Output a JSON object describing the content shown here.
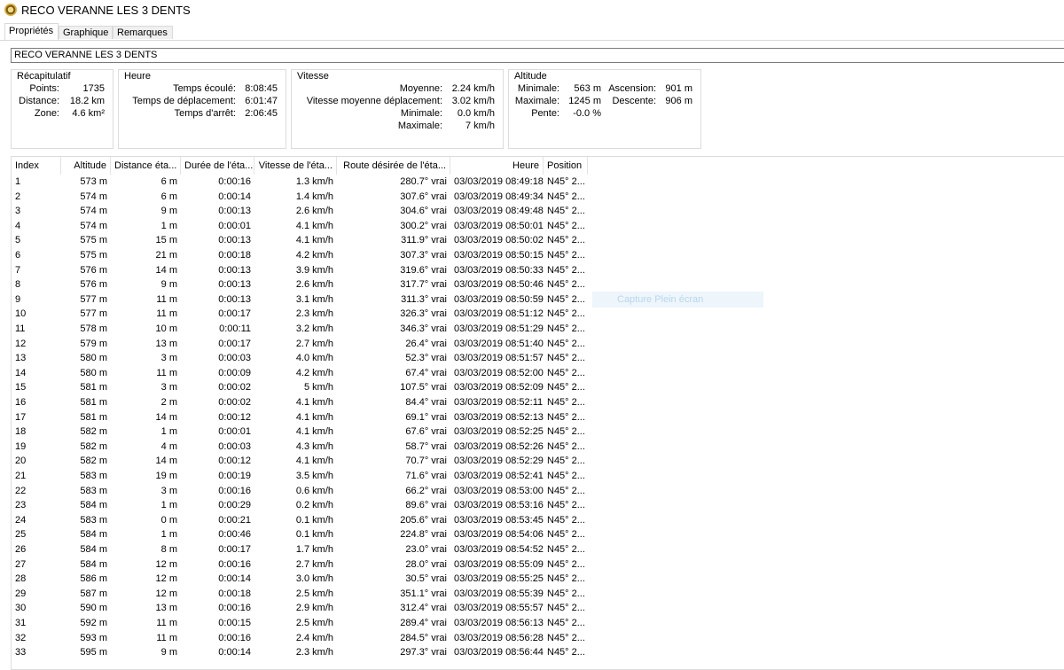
{
  "window": {
    "title": "RECO VERANNE LES 3 DENTS"
  },
  "tabs": [
    "Propriétés",
    "Graphique",
    "Remarques"
  ],
  "name_field": "RECO VERANNE LES 3 DENTS",
  "summary": {
    "title": "Récapitulatif",
    "points_label": "Points:",
    "points": "1735",
    "distance_label": "Distance:",
    "distance": "18.2 km",
    "zone_label": "Zone:",
    "zone": "4.6 km²"
  },
  "heure": {
    "title": "Heure",
    "elapsed_label": "Temps écoulé:",
    "elapsed": "8:08:45",
    "moving_label": "Temps de déplacement:",
    "moving": "6:01:47",
    "stopped_label": "Temps d'arrêt:",
    "stopped": "2:06:45"
  },
  "vitesse": {
    "title": "Vitesse",
    "avg_label": "Moyenne:",
    "avg": "2.24 km/h",
    "avg_moving_label": "Vitesse moyenne déplacement:",
    "avg_moving": "3.02 km/h",
    "min_label": "Minimale:",
    "min": "0.0 km/h",
    "max_label": "Maximale:",
    "max": "7 km/h"
  },
  "altitude": {
    "title": "Altitude",
    "min_label": "Minimale:",
    "min": "563 m",
    "max_label": "Maximale:",
    "max": "1245 m",
    "slope_label": "Pente:",
    "slope": "-0.0 %",
    "ascent_label": "Ascension:",
    "ascent": "901 m",
    "descent_label": "Descente:",
    "descent": "906 m"
  },
  "table": {
    "headers": [
      "Index",
      "Altitude",
      "Distance éta...",
      "Durée de l'éta...",
      "Vitesse de l'éta...",
      "Route désirée de l'éta...",
      "Heure",
      "Position"
    ],
    "rows": [
      [
        "1",
        "573 m",
        "6 m",
        "0:00:16",
        "1.3 km/h",
        "280.7° vrai",
        "03/03/2019 08:49:18",
        "N45° 2..."
      ],
      [
        "2",
        "574 m",
        "6 m",
        "0:00:14",
        "1.4 km/h",
        "307.6° vrai",
        "03/03/2019 08:49:34",
        "N45° 2..."
      ],
      [
        "3",
        "574 m",
        "9 m",
        "0:00:13",
        "2.6 km/h",
        "304.6° vrai",
        "03/03/2019 08:49:48",
        "N45° 2..."
      ],
      [
        "4",
        "574 m",
        "1 m",
        "0:00:01",
        "4.1 km/h",
        "300.2° vrai",
        "03/03/2019 08:50:01",
        "N45° 2..."
      ],
      [
        "5",
        "575 m",
        "15 m",
        "0:00:13",
        "4.1 km/h",
        "311.9° vrai",
        "03/03/2019 08:50:02",
        "N45° 2..."
      ],
      [
        "6",
        "575 m",
        "21 m",
        "0:00:18",
        "4.2 km/h",
        "307.3° vrai",
        "03/03/2019 08:50:15",
        "N45° 2..."
      ],
      [
        "7",
        "576 m",
        "14 m",
        "0:00:13",
        "3.9 km/h",
        "319.6° vrai",
        "03/03/2019 08:50:33",
        "N45° 2..."
      ],
      [
        "8",
        "576 m",
        "9 m",
        "0:00:13",
        "2.6 km/h",
        "317.7° vrai",
        "03/03/2019 08:50:46",
        "N45° 2..."
      ],
      [
        "9",
        "577 m",
        "11 m",
        "0:00:13",
        "3.1 km/h",
        "311.3° vrai",
        "03/03/2019 08:50:59",
        "N45° 2..."
      ],
      [
        "10",
        "577 m",
        "11 m",
        "0:00:17",
        "2.3 km/h",
        "326.3° vrai",
        "03/03/2019 08:51:12",
        "N45° 2..."
      ],
      [
        "11",
        "578 m",
        "10 m",
        "0:00:11",
        "3.2 km/h",
        "346.3° vrai",
        "03/03/2019 08:51:29",
        "N45° 2..."
      ],
      [
        "12",
        "579 m",
        "13 m",
        "0:00:17",
        "2.7 km/h",
        "26.4° vrai",
        "03/03/2019 08:51:40",
        "N45° 2..."
      ],
      [
        "13",
        "580 m",
        "3 m",
        "0:00:03",
        "4.0 km/h",
        "52.3° vrai",
        "03/03/2019 08:51:57",
        "N45° 2..."
      ],
      [
        "14",
        "580 m",
        "11 m",
        "0:00:09",
        "4.2 km/h",
        "67.4° vrai",
        "03/03/2019 08:52:00",
        "N45° 2..."
      ],
      [
        "15",
        "581 m",
        "3 m",
        "0:00:02",
        "5 km/h",
        "107.5° vrai",
        "03/03/2019 08:52:09",
        "N45° 2..."
      ],
      [
        "16",
        "581 m",
        "2 m",
        "0:00:02",
        "4.1 km/h",
        "84.4° vrai",
        "03/03/2019 08:52:11",
        "N45° 2..."
      ],
      [
        "17",
        "581 m",
        "14 m",
        "0:00:12",
        "4.1 km/h",
        "69.1° vrai",
        "03/03/2019 08:52:13",
        "N45° 2..."
      ],
      [
        "18",
        "582 m",
        "1 m",
        "0:00:01",
        "4.1 km/h",
        "67.6° vrai",
        "03/03/2019 08:52:25",
        "N45° 2..."
      ],
      [
        "19",
        "582 m",
        "4 m",
        "0:00:03",
        "4.3 km/h",
        "58.7° vrai",
        "03/03/2019 08:52:26",
        "N45° 2..."
      ],
      [
        "20",
        "582 m",
        "14 m",
        "0:00:12",
        "4.1 km/h",
        "70.7° vrai",
        "03/03/2019 08:52:29",
        "N45° 2..."
      ],
      [
        "21",
        "583 m",
        "19 m",
        "0:00:19",
        "3.5 km/h",
        "71.6° vrai",
        "03/03/2019 08:52:41",
        "N45° 2..."
      ],
      [
        "22",
        "583 m",
        "3 m",
        "0:00:16",
        "0.6 km/h",
        "66.2° vrai",
        "03/03/2019 08:53:00",
        "N45° 2..."
      ],
      [
        "23",
        "584 m",
        "1 m",
        "0:00:29",
        "0.2 km/h",
        "89.6° vrai",
        "03/03/2019 08:53:16",
        "N45° 2..."
      ],
      [
        "24",
        "583 m",
        "0 m",
        "0:00:21",
        "0.1 km/h",
        "205.6° vrai",
        "03/03/2019 08:53:45",
        "N45° 2..."
      ],
      [
        "25",
        "584 m",
        "1 m",
        "0:00:46",
        "0.1 km/h",
        "224.8° vrai",
        "03/03/2019 08:54:06",
        "N45° 2..."
      ],
      [
        "26",
        "584 m",
        "8 m",
        "0:00:17",
        "1.7 km/h",
        "23.0° vrai",
        "03/03/2019 08:54:52",
        "N45° 2..."
      ],
      [
        "27",
        "584 m",
        "12 m",
        "0:00:16",
        "2.7 km/h",
        "28.0° vrai",
        "03/03/2019 08:55:09",
        "N45° 2..."
      ],
      [
        "28",
        "586 m",
        "12 m",
        "0:00:14",
        "3.0 km/h",
        "30.5° vrai",
        "03/03/2019 08:55:25",
        "N45° 2..."
      ],
      [
        "29",
        "587 m",
        "12 m",
        "0:00:18",
        "2.5 km/h",
        "351.1° vrai",
        "03/03/2019 08:55:39",
        "N45° 2..."
      ],
      [
        "30",
        "590 m",
        "13 m",
        "0:00:16",
        "2.9 km/h",
        "312.4° vrai",
        "03/03/2019 08:55:57",
        "N45° 2..."
      ],
      [
        "31",
        "592 m",
        "11 m",
        "0:00:15",
        "2.5 km/h",
        "289.4° vrai",
        "03/03/2019 08:56:13",
        "N45° 2..."
      ],
      [
        "32",
        "593 m",
        "11 m",
        "0:00:16",
        "2.4 km/h",
        "284.5° vrai",
        "03/03/2019 08:56:28",
        "N45° 2..."
      ],
      [
        "33",
        "595 m",
        "9 m",
        "0:00:14",
        "2.3 km/h",
        "297.3° vrai",
        "03/03/2019 08:56:44",
        "N45° 2..."
      ]
    ]
  },
  "ghost_tooltip": "Capture Plein écran"
}
